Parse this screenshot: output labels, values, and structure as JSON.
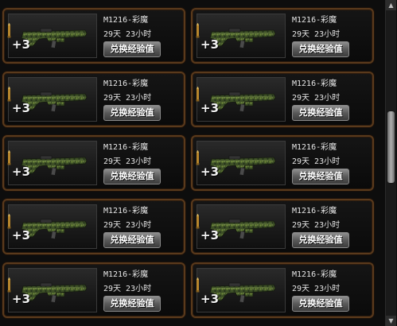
{
  "inventory": {
    "items": [
      {
        "name": "M1216-彩魔",
        "time_left": "29天 23小时",
        "level_badge": "+3",
        "action_label": "兑换经验值"
      },
      {
        "name": "M1216-彩魔",
        "time_left": "29天 23小时",
        "level_badge": "+3",
        "action_label": "兑换经验值"
      },
      {
        "name": "M1216-彩魔",
        "time_left": "29天 23小时",
        "level_badge": "+3",
        "action_label": "兑换经验值"
      },
      {
        "name": "M1216-彩魔",
        "time_left": "29天 23小时",
        "level_badge": "+3",
        "action_label": "兑换经验值"
      },
      {
        "name": "M1216-彩魔",
        "time_left": "29天 23小时",
        "level_badge": "+3",
        "action_label": "兑换经验值"
      },
      {
        "name": "M1216-彩魔",
        "time_left": "29天 23小时",
        "level_badge": "+3",
        "action_label": "兑换经验值"
      },
      {
        "name": "M1216-彩魔",
        "time_left": "29天 23小时",
        "level_badge": "+3",
        "action_label": "兑换经验值"
      },
      {
        "name": "M1216-彩魔",
        "time_left": "29天 23小时",
        "level_badge": "+3",
        "action_label": "兑换经验值"
      },
      {
        "name": "M1216-彩魔",
        "time_left": "29天 23小时",
        "level_badge": "+3",
        "action_label": "兑换经验值"
      },
      {
        "name": "M1216-彩魔",
        "time_left": "29天 23小时",
        "level_badge": "+3",
        "action_label": "兑换经验值"
      }
    ]
  },
  "icons": {
    "weapon": "shotgun-icon",
    "ammo": "bullet-icon",
    "scroll_up": "chevron-up-icon",
    "scroll_down": "chevron-down-icon"
  },
  "colors": {
    "card_border": "#5a3a1c",
    "background": "#0d0d0d",
    "text": "#e6e6e6",
    "button": "#5a5a5a"
  }
}
